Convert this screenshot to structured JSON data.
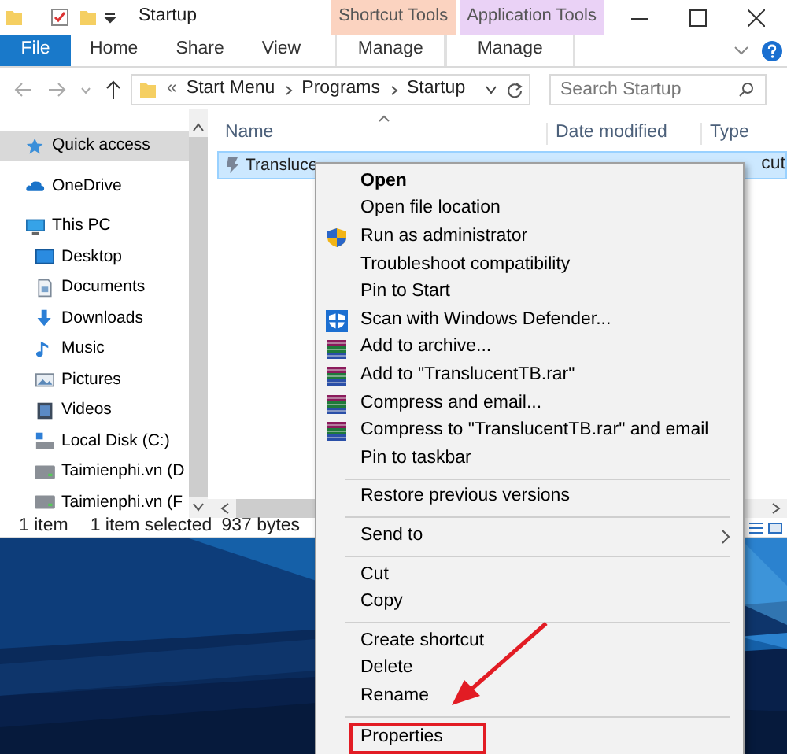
{
  "window": {
    "title": "Startup",
    "contextual_tabs": [
      {
        "label": "Shortcut Tools",
        "color": "#fbd3c0"
      },
      {
        "label": "Application Tools",
        "color": "#ead2f6"
      }
    ]
  },
  "ribbon": {
    "tabs": [
      {
        "label": "File",
        "kind": "file"
      },
      {
        "label": "Home",
        "kind": "tab"
      },
      {
        "label": "Share",
        "kind": "tab"
      },
      {
        "label": "View",
        "kind": "tab"
      },
      {
        "label": "Manage",
        "kind": "context"
      },
      {
        "label": "Manage",
        "kind": "context"
      }
    ]
  },
  "address_bar": {
    "overflow": "«",
    "breadcrumbs": [
      "Start Menu",
      "Programs",
      "Startup"
    ],
    "search": {
      "placeholder": "Search Startup"
    }
  },
  "navigation": {
    "items": [
      {
        "label": "Quick access",
        "kind": "star",
        "selected": true
      },
      {
        "label": "OneDrive",
        "kind": "cloud",
        "selected": false
      },
      {
        "label": "This PC",
        "kind": "pc",
        "selected": false,
        "children": [
          {
            "label": "Desktop",
            "kind": "desktop",
            "selected": false
          },
          {
            "label": "Documents",
            "kind": "documents",
            "selected": false
          },
          {
            "label": "Downloads",
            "kind": "downloads",
            "selected": false
          },
          {
            "label": "Music",
            "kind": "music",
            "selected": false
          },
          {
            "label": "Pictures",
            "kind": "pictures",
            "selected": false
          },
          {
            "label": "Videos",
            "kind": "videos",
            "selected": false
          },
          {
            "label": "Local Disk (C:)",
            "kind": "disk",
            "selected": false
          },
          {
            "label": "Taimienphi.vn (D",
            "kind": "drive",
            "selected": false
          },
          {
            "label": "Taimienphi.vn (F",
            "kind": "drive",
            "selected": false
          }
        ]
      }
    ]
  },
  "file_list": {
    "columns": [
      "Name",
      "Date modified",
      "Type"
    ],
    "rows": [
      {
        "name": "Transluce",
        "type": "cut",
        "selected": true
      }
    ]
  },
  "status_bar": {
    "count": "1 item",
    "selection": "1 item selected",
    "size": "937 bytes"
  },
  "context_menu": {
    "groups": [
      [
        {
          "label": "Open",
          "kind": "default",
          "boxed": false
        },
        {
          "label": "Open file location",
          "kind": "plain",
          "boxed": false
        },
        {
          "label": "Run as administrator",
          "kind": "shield",
          "boxed": false
        },
        {
          "label": "Troubleshoot compatibility",
          "kind": "plain",
          "boxed": false
        },
        {
          "label": "Pin to Start",
          "kind": "plain",
          "boxed": false
        },
        {
          "label": "Scan with Windows Defender...",
          "kind": "defender",
          "boxed": false
        },
        {
          "label": "Add to archive...",
          "kind": "archive",
          "boxed": false
        },
        {
          "label": "Add to \"TranslucentTB.rar\"",
          "kind": "archive",
          "boxed": false
        },
        {
          "label": "Compress and email...",
          "kind": "archive",
          "boxed": false
        },
        {
          "label": "Compress to \"TranslucentTB.rar\" and email",
          "kind": "archive",
          "boxed": false
        },
        {
          "label": "Pin to taskbar",
          "kind": "plain",
          "boxed": false
        }
      ],
      [
        {
          "label": "Restore previous versions",
          "kind": "plain",
          "boxed": false
        }
      ],
      [
        {
          "label": "Send to",
          "kind": "submenu",
          "boxed": false
        }
      ],
      [
        {
          "label": "Cut",
          "kind": "plain",
          "boxed": false
        },
        {
          "label": "Copy",
          "kind": "plain",
          "boxed": false
        }
      ],
      [
        {
          "label": "Create shortcut",
          "kind": "plain",
          "boxed": false
        },
        {
          "label": "Delete",
          "kind": "plain",
          "boxed": false
        },
        {
          "label": "Rename",
          "kind": "plain",
          "boxed": false
        }
      ],
      [
        {
          "label": "Properties",
          "kind": "plain",
          "boxed": true
        }
      ]
    ]
  }
}
